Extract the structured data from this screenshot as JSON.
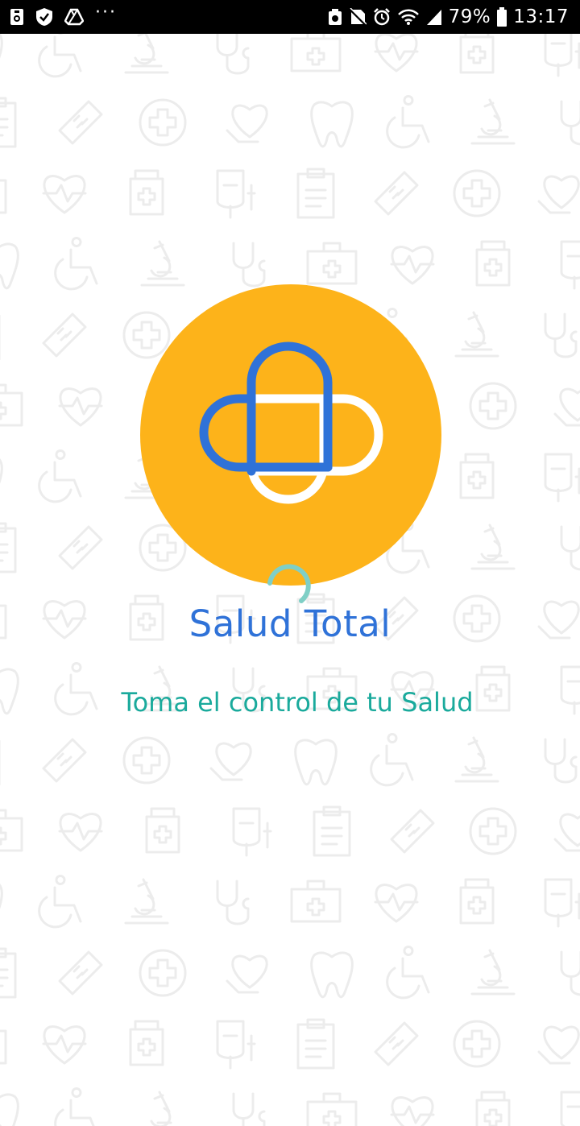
{
  "status_bar": {
    "battery_percent": "79%",
    "time": "13:17",
    "left_icons": [
      "storage-icon",
      "shield-check-icon",
      "drive-icon",
      "more-dots-icon"
    ],
    "right_icons": [
      "cleaner-icon",
      "no-sim-icon",
      "alarm-icon",
      "wifi-icon",
      "signal-icon",
      "battery-icon"
    ]
  },
  "splash": {
    "app_name": "Salud Total",
    "tagline": "Toma el control de tu Salud",
    "logo_colors": {
      "circle": "#fdb31a",
      "pill_blue": "#2f72d8",
      "pill_white": "#ffffff"
    },
    "spinner_color": "#7fcfc6"
  },
  "background": {
    "pattern_icons": [
      "tooth-icon",
      "wheelchair-icon",
      "microscope-icon",
      "stethoscope-icon",
      "first-aid-kit-icon",
      "heart-pulse-icon",
      "medicine-bottle-icon",
      "iv-bag-icon",
      "clipboard-icon",
      "bandage-icon",
      "medical-cross-icon",
      "heart-hand-icon"
    ],
    "pattern_color": "#ececec"
  }
}
